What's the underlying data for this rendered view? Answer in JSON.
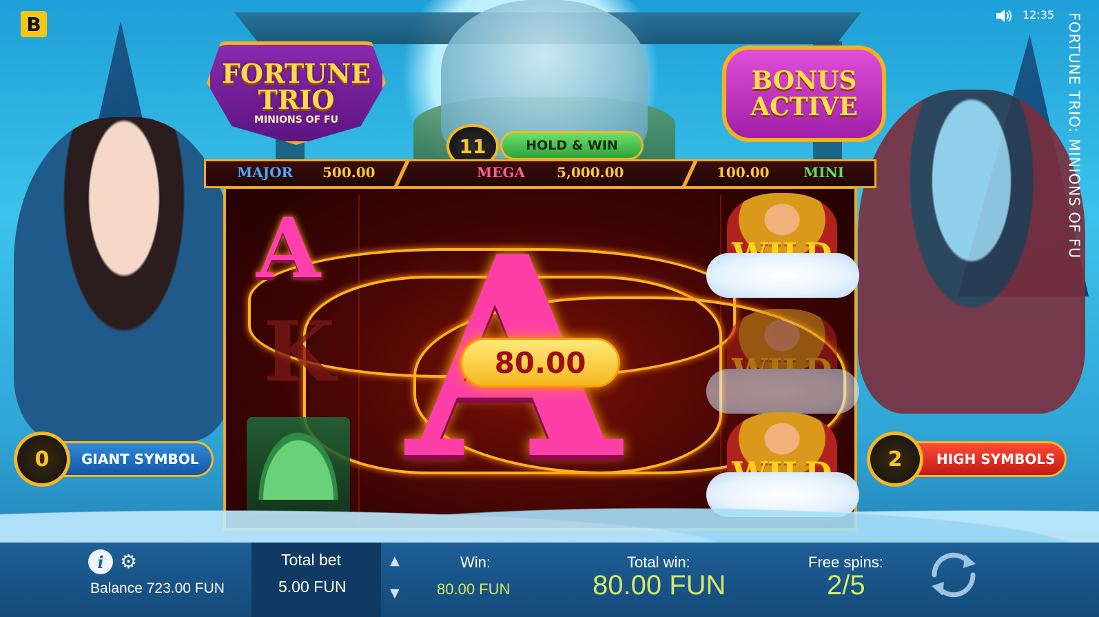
{
  "brand": {
    "badge": "B"
  },
  "status": {
    "time": "12:35",
    "sound_icon": "speaker-icon"
  },
  "vertical_title": "FORTUNE TRIO: MINIONS OF FU",
  "logo": {
    "line1": "FORTUNE",
    "line2": "TRIO",
    "line3": "MINIONS OF FU"
  },
  "bonus": {
    "line1": "BONUS",
    "line2": "ACTIVE"
  },
  "hold_and_win": {
    "count": "11",
    "label": "HOLD & WIN"
  },
  "jackpots": {
    "major": {
      "label": "MAJOR",
      "value": "500.00"
    },
    "mega": {
      "label": "MEGA",
      "value": "5,000.00"
    },
    "mini": {
      "label": "MINI",
      "value": "100.00"
    }
  },
  "reels": {
    "symbols": {
      "a": "A",
      "k": "K",
      "wild": "WILD"
    },
    "win_amount": "80.00"
  },
  "feature_left": {
    "count": "0",
    "label": "GIANT SYMBOL"
  },
  "feature_right": {
    "count": "2",
    "label": "HIGH SYMBOLS"
  },
  "bottom_bar": {
    "balance": "Balance 723.00 FUN",
    "total_bet_label": "Total bet",
    "total_bet_value": "5.00 FUN",
    "bet_up": "▲",
    "bet_down": "▼",
    "win_label": "Win:",
    "win_value": "80.00 FUN",
    "total_win_label": "Total win:",
    "total_win_value": "80.00 FUN",
    "free_spins_label": "Free spins:",
    "free_spins_value": "2/5"
  },
  "colors": {
    "gold": "#f1a91f",
    "win_green": "#d6e86a",
    "pink_symbol": "#ff3fa8",
    "bar_blue": "#1e5f96"
  }
}
